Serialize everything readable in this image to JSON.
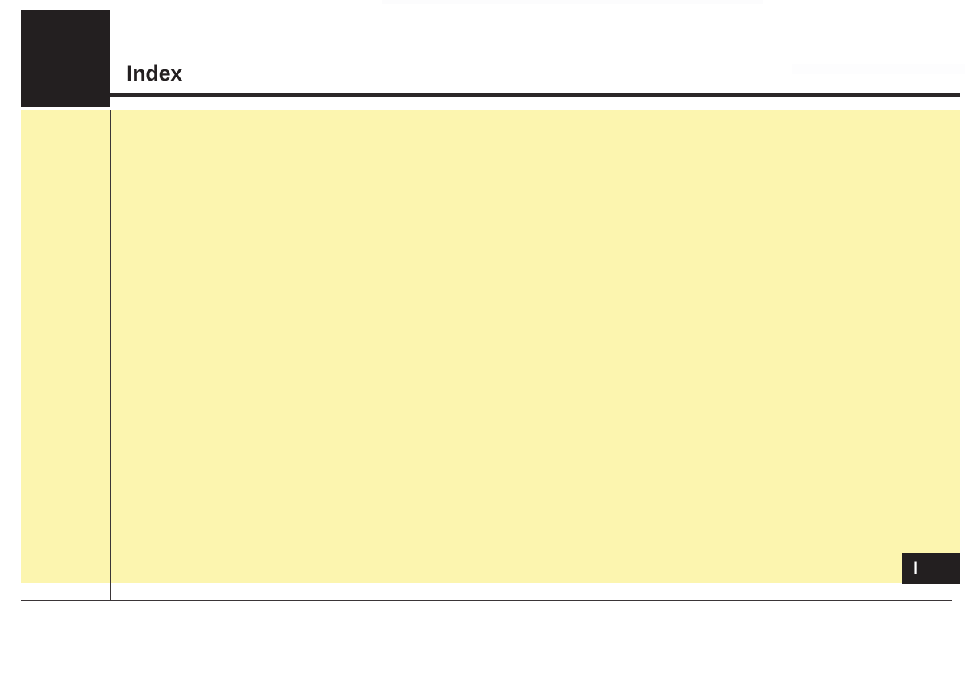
{
  "page": {
    "title": "Index",
    "background_color": "#ffffff"
  },
  "header": {
    "title": "Index",
    "chapter_block_color": "#231f20",
    "rule_color": "#2b2728"
  },
  "content": {
    "panel_color": "#fcf5af",
    "divider_color": "#3a3537",
    "body_text": ""
  },
  "footer": {
    "rule_color": "#3a3537"
  },
  "index_tab": {
    "letter": "I",
    "background_color": "#231f20",
    "text_color": "#ffffff"
  }
}
